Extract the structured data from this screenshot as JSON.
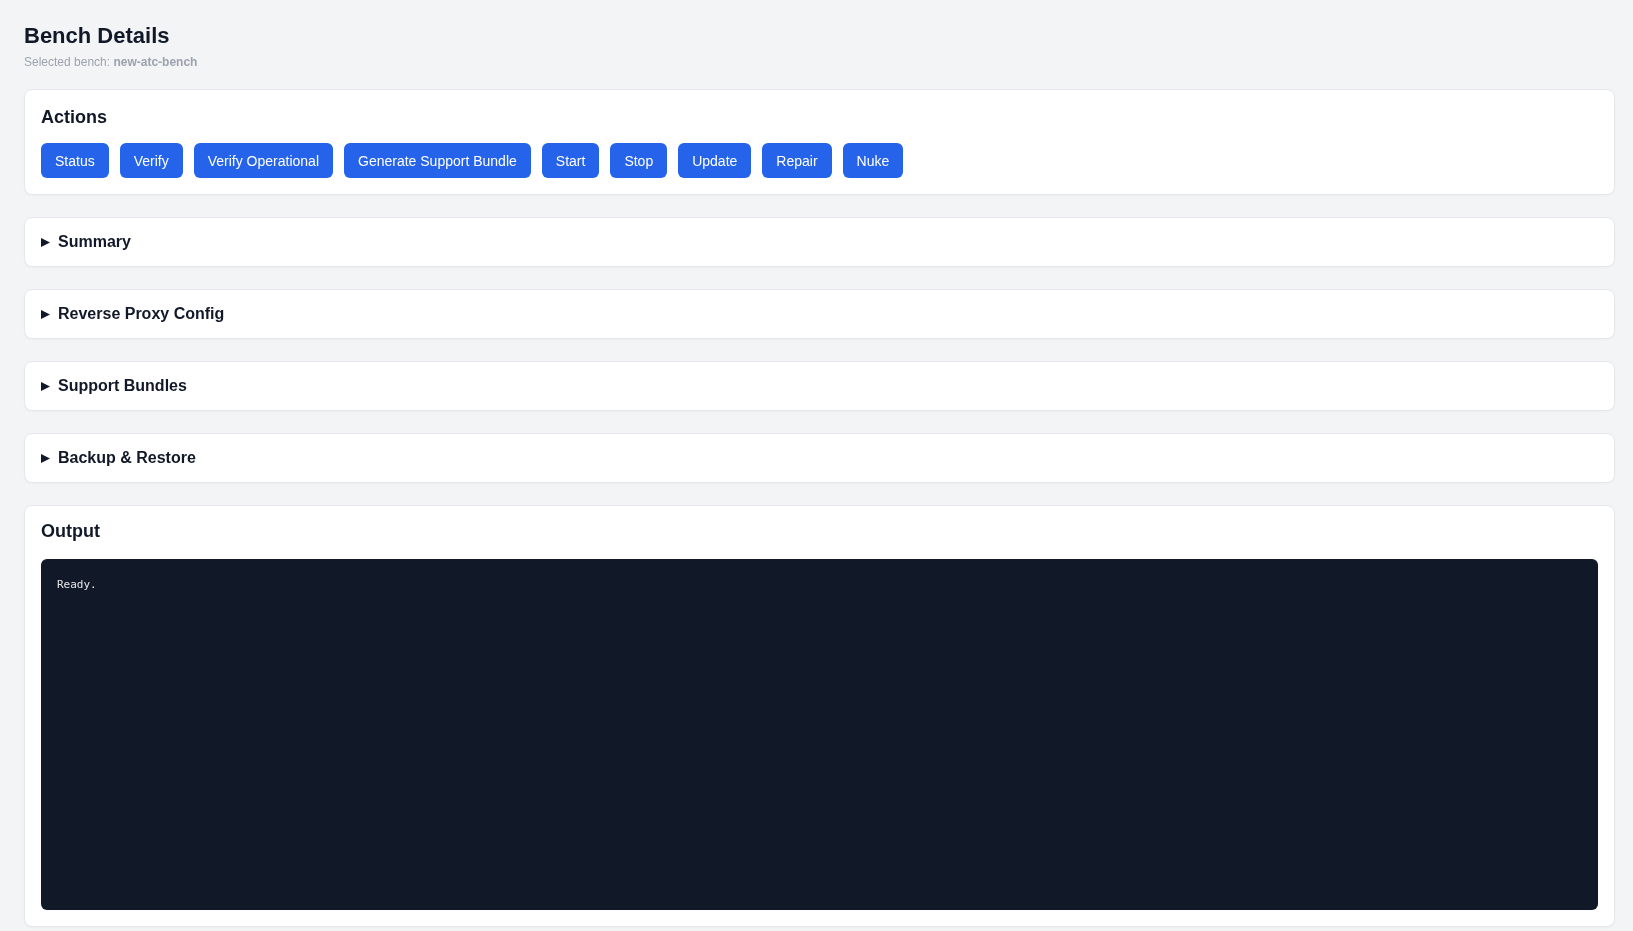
{
  "page": {
    "title": "Bench Details",
    "subtitle": "Selected bench: **new-atc-bench**"
  },
  "actions": {
    "title": "Actions",
    "buttons": [
      "Status",
      "Verify",
      "Verify Operational",
      "Generate Support Bundle",
      "Start",
      "Stop",
      "Update",
      "Repair",
      "Nuke"
    ]
  },
  "sections": [
    {
      "title": "Summary",
      "expanded": false
    },
    {
      "title": "Reverse Proxy Config",
      "expanded": false
    },
    {
      "title": "Support Bundles",
      "expanded": false
    },
    {
      "title": "Backup & Restore",
      "expanded": false
    }
  ],
  "output": {
    "title": "Output",
    "text": "Ready."
  }
}
